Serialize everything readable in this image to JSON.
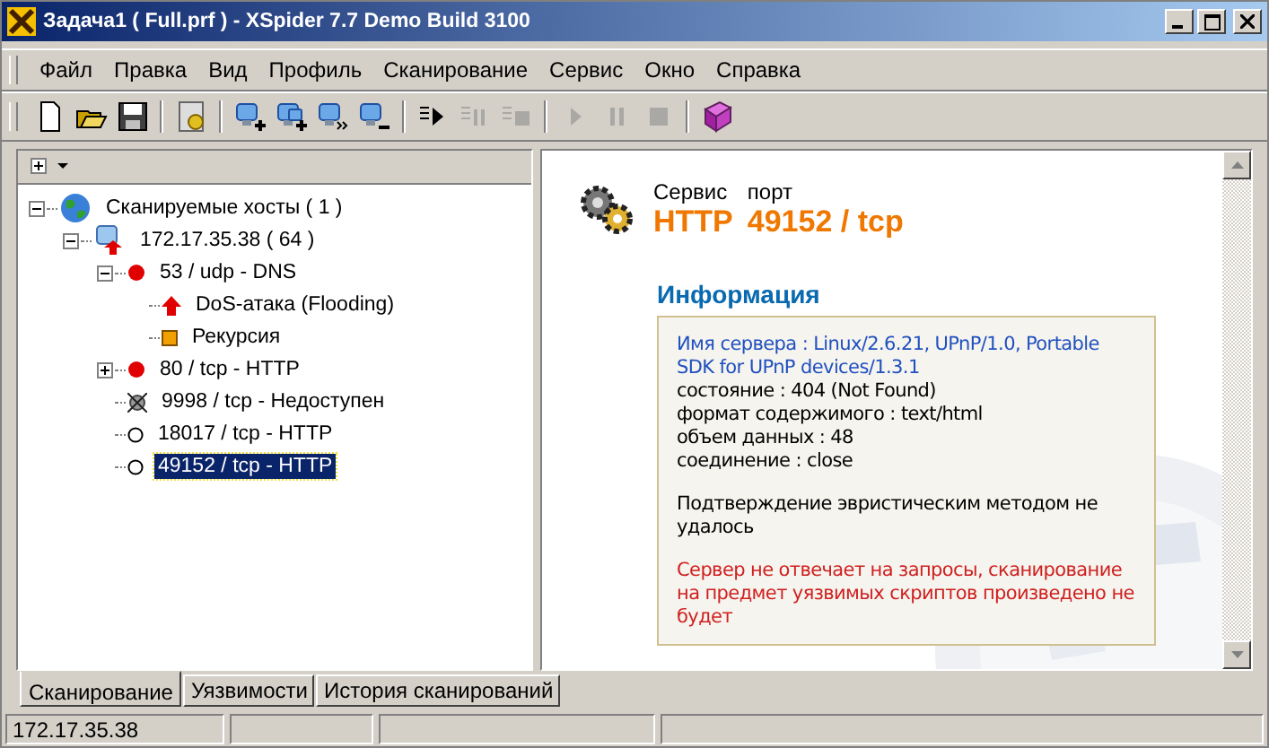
{
  "window": {
    "title": "Задача1 ( Full.prf ) - XSpider 7.7 Demo Build 3100"
  },
  "menu": [
    "Файл",
    "Правка",
    "Вид",
    "Профиль",
    "Сканирование",
    "Сервис",
    "Окно",
    "Справка"
  ],
  "toolbar": [
    {
      "kind": "new",
      "disabled": false
    },
    {
      "kind": "open",
      "disabled": false
    },
    {
      "kind": "save",
      "disabled": false
    },
    {
      "kind": "sep"
    },
    {
      "kind": "profile",
      "disabled": false
    },
    {
      "kind": "sep"
    },
    {
      "kind": "host-add",
      "disabled": false
    },
    {
      "kind": "hosts-add",
      "disabled": false
    },
    {
      "kind": "host-go",
      "disabled": false
    },
    {
      "kind": "host-remove",
      "disabled": false
    },
    {
      "kind": "sep"
    },
    {
      "kind": "queue-run",
      "disabled": false
    },
    {
      "kind": "queue-pause",
      "disabled": true
    },
    {
      "kind": "queue-stop",
      "disabled": true
    },
    {
      "kind": "sep"
    },
    {
      "kind": "play",
      "disabled": true
    },
    {
      "kind": "pause",
      "disabled": true
    },
    {
      "kind": "stop",
      "disabled": true
    },
    {
      "kind": "sep"
    },
    {
      "kind": "book",
      "disabled": false
    }
  ],
  "tree": [
    {
      "kind": "globe",
      "label": "Сканируемые хосты ( 1 )",
      "expanded": true,
      "selected": false,
      "children": [
        {
          "kind": "host",
          "label": "172.17.35.38 ( 64 )",
          "expanded": true,
          "selected": false,
          "children": [
            {
              "kind": "port-vuln",
              "label": "53 / udp - DNS",
              "expanded": true,
              "selected": false,
              "children": [
                {
                  "kind": "alert",
                  "label": "DoS-атака (Flooding)",
                  "selected": false
                },
                {
                  "kind": "warning",
                  "label": "Рекурсия",
                  "selected": false
                }
              ]
            },
            {
              "kind": "port-vuln",
              "label": "80 / tcp - HTTP",
              "expanded": false,
              "selected": false
            },
            {
              "kind": "port-closed",
              "label": "9998 / tcp - Недоступен",
              "selected": false
            },
            {
              "kind": "port-open",
              "label": "18017 / tcp - HTTP",
              "selected": false
            },
            {
              "kind": "port-open",
              "label": "49152 / tcp - HTTP",
              "selected": true
            }
          ]
        }
      ]
    }
  ],
  "detail": {
    "service_caption": "Сервис",
    "port_caption": "порт",
    "service": "HTTP",
    "port": "49152 / tcp",
    "section_title": "Информация",
    "info": [
      {
        "kind": "link",
        "text": "Имя сервера : Linux/2.6.21, UPnP/1.0, Portable SDK for UPnP devices/1.3.1"
      },
      {
        "kind": "plain",
        "text": "состояние : 404 (Not Found)"
      },
      {
        "kind": "plain",
        "text": "формат содержимого : text/html"
      },
      {
        "kind": "plain",
        "text": "объем данных : 48"
      },
      {
        "kind": "plain",
        "text": "соединение : close"
      },
      {
        "kind": "gap"
      },
      {
        "kind": "plain",
        "text": "Подтверждение эвристическим методом не удалось"
      },
      {
        "kind": "gap"
      },
      {
        "kind": "error",
        "text": "Сервер не отвечает на запросы, сканирование на предмет уязвимых скриптов произведено не будет"
      }
    ]
  },
  "tabs": [
    {
      "label": "Сканирование",
      "selected": true
    },
    {
      "label": "Уязвимости",
      "selected": false
    },
    {
      "label": "История сканирований",
      "selected": false
    }
  ],
  "status_bar": [
    "172.17.35.38"
  ]
}
